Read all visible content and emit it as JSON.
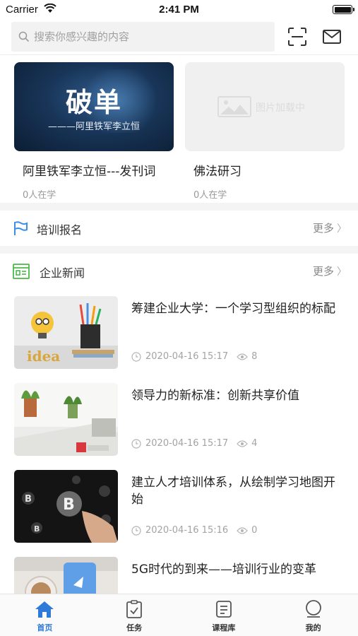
{
  "status_bar": {
    "carrier": "Carrier",
    "time": "2:41 PM"
  },
  "search": {
    "placeholder": "搜索你感兴趣的内容"
  },
  "courses": [
    {
      "thumb_big": "破单",
      "thumb_sub": "———阿里铁军李立恒",
      "title": "阿里铁军李立恒---发刊词",
      "learners": "0人在学"
    },
    {
      "thumb_placeholder": "图片加载中",
      "title": "佛法研习",
      "learners": "0人在学"
    }
  ],
  "training": {
    "title": "培训报名",
    "more": "更多"
  },
  "news_section": {
    "title": "企业新闻",
    "more": "更多"
  },
  "news": [
    {
      "title": "筹建企业大学：一个学习型组织的标配",
      "date": "2020-04-16 15:17",
      "views": "8",
      "image": "idea-lightbulb"
    },
    {
      "title": "领导力的新标准：创新共享价值",
      "date": "2020-04-16 15:17",
      "views": "4",
      "image": "office-desk"
    },
    {
      "title": "建立人才培训体系，从绘制学习地图开始",
      "date": "2020-04-16 15:16",
      "views": "0",
      "image": "bitcoin-hand"
    },
    {
      "title": "5G时代的到来——培训行业的变革",
      "image": "phone-coffee"
    }
  ],
  "tabbar": [
    {
      "label": "首页",
      "icon": "home-icon",
      "active": true
    },
    {
      "label": "任务",
      "icon": "task-icon"
    },
    {
      "label": "课程库",
      "icon": "course-library-icon"
    },
    {
      "label": "我的",
      "icon": "profile-icon"
    }
  ],
  "colors": {
    "accent": "#2f79d8",
    "divider": "#f4f4f5",
    "section_icon_blue": "#3a8ee6",
    "section_icon_green": "#4cb84a"
  }
}
